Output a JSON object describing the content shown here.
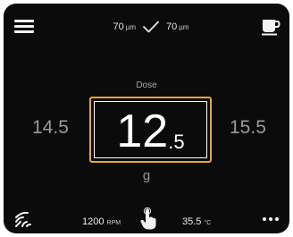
{
  "top_bar": {
    "menu_icon": "hamburger-menu-icon",
    "grind_left": {
      "value": "70",
      "unit": "µm"
    },
    "grind_right": {
      "value": "70",
      "unit": "µm"
    },
    "status_icon": "check-icon",
    "cup_icon": "coffee-cup-icon"
  },
  "dose": {
    "label": "Dose",
    "previous": "14.5",
    "current_main": "12",
    "current_decimal": ".5",
    "next": "15.5",
    "unit": "g"
  },
  "bottom_bar": {
    "wifi_icon": "wifi-signal-icon",
    "rpm": {
      "value": "1200",
      "unit": "RPM"
    },
    "touch_icon": "hand-touch-icon",
    "temperature": {
      "value": "35.5",
      "unit": "°C"
    },
    "more_icon": "more-options-icon"
  },
  "colors": {
    "background": "#0b0b0b",
    "accent": "#e5a73e",
    "text": "#ffffff",
    "muted": "#9a9a9a"
  }
}
